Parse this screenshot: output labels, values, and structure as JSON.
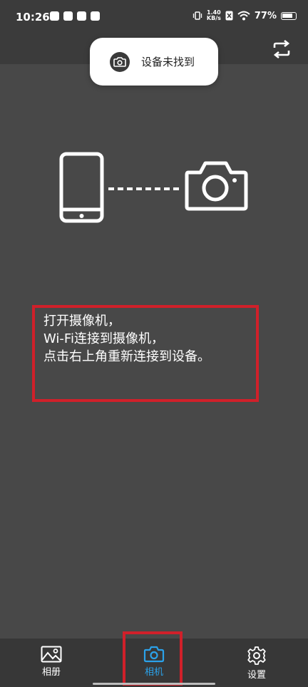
{
  "status_bar": {
    "time": "10:26",
    "net_speed_value": "1.40",
    "net_speed_unit": "KB/s",
    "battery_percent": "77%"
  },
  "toast": {
    "message": "设备未找到",
    "icon": "camera-icon"
  },
  "app_bar": {
    "reconnect_icon": "refresh-icon"
  },
  "instructions": {
    "line1": "打开摄像机，",
    "line2": "Wi-Fi连接到摄像机，",
    "line3": "点击右上角重新连接到设备。"
  },
  "bottom_nav": {
    "items": [
      {
        "label": "相册",
        "icon": "image-icon",
        "active": false
      },
      {
        "label": "相机",
        "icon": "camera-icon",
        "active": true
      },
      {
        "label": "设置",
        "icon": "gear-icon",
        "active": false
      }
    ]
  },
  "colors": {
    "background": "#484848",
    "active": "#2ba2ea",
    "highlight": "#d0202a"
  }
}
